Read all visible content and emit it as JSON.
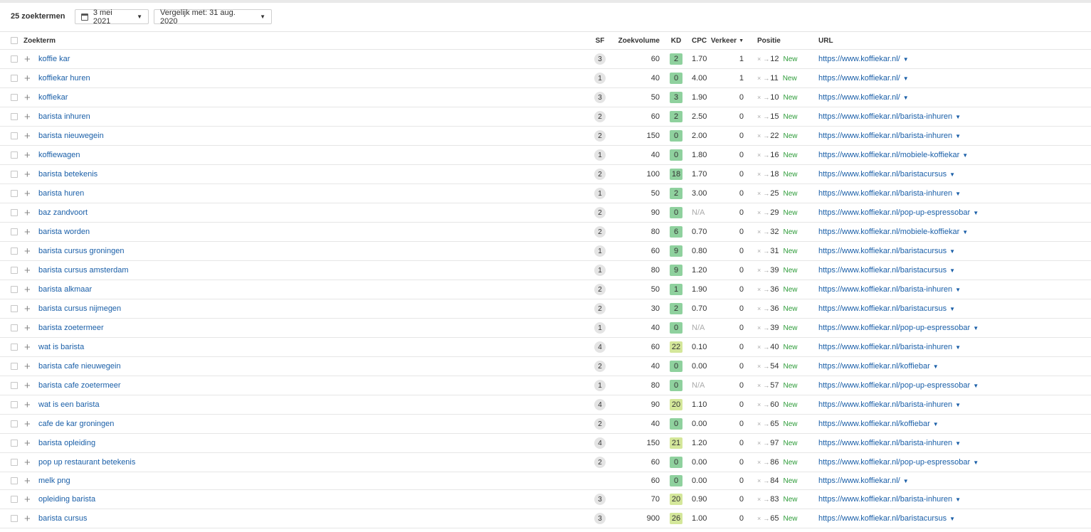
{
  "toolbar": {
    "count_label": "25 zoektermen",
    "date_label": "3 mei 2021",
    "compare_label": "Vergelijk met: 31 aug. 2020"
  },
  "columns": {
    "keyword": "Zoekterm",
    "sf": "SF",
    "volume": "Zoekvolume",
    "kd": "KD",
    "cpc": "CPC",
    "traffic": "Verkeer",
    "position": "Positie",
    "url": "URL"
  },
  "colors": {
    "kd_green": "#8fd19e",
    "kd_yellow_green": "#d4e79a",
    "link": "#1a5fa8",
    "new": "#2e9c3a"
  },
  "rows": [
    {
      "keyword": "koffie kar",
      "sf": "3",
      "volume": "60",
      "kd": "2",
      "kd_color": "#8fd19e",
      "cpc": "1.70",
      "cpc_na": false,
      "traffic": "1",
      "position": "12",
      "status": "New",
      "url": "https://www.koffiekar.nl/"
    },
    {
      "keyword": "koffiekar huren",
      "sf": "1",
      "volume": "40",
      "kd": "0",
      "kd_color": "#8fd19e",
      "cpc": "4.00",
      "cpc_na": false,
      "traffic": "1",
      "position": "11",
      "status": "New",
      "url": "https://www.koffiekar.nl/"
    },
    {
      "keyword": "koffiekar",
      "sf": "3",
      "volume": "50",
      "kd": "3",
      "kd_color": "#8fd19e",
      "cpc": "1.90",
      "cpc_na": false,
      "traffic": "0",
      "position": "10",
      "status": "New",
      "url": "https://www.koffiekar.nl/"
    },
    {
      "keyword": "barista inhuren",
      "sf": "2",
      "volume": "60",
      "kd": "2",
      "kd_color": "#8fd19e",
      "cpc": "2.50",
      "cpc_na": false,
      "traffic": "0",
      "position": "15",
      "status": "New",
      "url": "https://www.koffiekar.nl/barista-inhuren"
    },
    {
      "keyword": "barista nieuwegein",
      "sf": "2",
      "volume": "150",
      "kd": "0",
      "kd_color": "#8fd19e",
      "cpc": "2.00",
      "cpc_na": false,
      "traffic": "0",
      "position": "22",
      "status": "New",
      "url": "https://www.koffiekar.nl/barista-inhuren"
    },
    {
      "keyword": "koffiewagen",
      "sf": "1",
      "volume": "40",
      "kd": "0",
      "kd_color": "#8fd19e",
      "cpc": "1.80",
      "cpc_na": false,
      "traffic": "0",
      "position": "16",
      "status": "New",
      "url": "https://www.koffiekar.nl/mobiele-koffiekar"
    },
    {
      "keyword": "barista betekenis",
      "sf": "2",
      "volume": "100",
      "kd": "18",
      "kd_color": "#8fd19e",
      "cpc": "1.70",
      "cpc_na": false,
      "traffic": "0",
      "position": "18",
      "status": "New",
      "url": "https://www.koffiekar.nl/baristacursus"
    },
    {
      "keyword": "barista huren",
      "sf": "1",
      "volume": "50",
      "kd": "2",
      "kd_color": "#8fd19e",
      "cpc": "3.00",
      "cpc_na": false,
      "traffic": "0",
      "position": "25",
      "status": "New",
      "url": "https://www.koffiekar.nl/barista-inhuren"
    },
    {
      "keyword": "baz zandvoort",
      "sf": "2",
      "volume": "90",
      "kd": "0",
      "kd_color": "#8fd19e",
      "cpc": "N/A",
      "cpc_na": true,
      "traffic": "0",
      "position": "29",
      "status": "New",
      "url": "https://www.koffiekar.nl/pop-up-espressobar"
    },
    {
      "keyword": "barista worden",
      "sf": "2",
      "volume": "80",
      "kd": "6",
      "kd_color": "#8fd19e",
      "cpc": "0.70",
      "cpc_na": false,
      "traffic": "0",
      "position": "32",
      "status": "New",
      "url": "https://www.koffiekar.nl/mobiele-koffiekar"
    },
    {
      "keyword": "barista cursus groningen",
      "sf": "1",
      "volume": "60",
      "kd": "9",
      "kd_color": "#8fd19e",
      "cpc": "0.80",
      "cpc_na": false,
      "traffic": "0",
      "position": "31",
      "status": "New",
      "url": "https://www.koffiekar.nl/baristacursus"
    },
    {
      "keyword": "barista cursus amsterdam",
      "sf": "1",
      "volume": "80",
      "kd": "9",
      "kd_color": "#8fd19e",
      "cpc": "1.20",
      "cpc_na": false,
      "traffic": "0",
      "position": "39",
      "status": "New",
      "url": "https://www.koffiekar.nl/baristacursus"
    },
    {
      "keyword": "barista alkmaar",
      "sf": "2",
      "volume": "50",
      "kd": "1",
      "kd_color": "#8fd19e",
      "cpc": "1.90",
      "cpc_na": false,
      "traffic": "0",
      "position": "36",
      "status": "New",
      "url": "https://www.koffiekar.nl/barista-inhuren"
    },
    {
      "keyword": "barista cursus nijmegen",
      "sf": "2",
      "volume": "30",
      "kd": "2",
      "kd_color": "#8fd19e",
      "cpc": "0.70",
      "cpc_na": false,
      "traffic": "0",
      "position": "36",
      "status": "New",
      "url": "https://www.koffiekar.nl/baristacursus"
    },
    {
      "keyword": "barista zoetermeer",
      "sf": "1",
      "volume": "40",
      "kd": "0",
      "kd_color": "#8fd19e",
      "cpc": "N/A",
      "cpc_na": true,
      "traffic": "0",
      "position": "39",
      "status": "New",
      "url": "https://www.koffiekar.nl/pop-up-espressobar"
    },
    {
      "keyword": "wat is barista",
      "sf": "4",
      "volume": "60",
      "kd": "22",
      "kd_color": "#d4e79a",
      "cpc": "0.10",
      "cpc_na": false,
      "traffic": "0",
      "position": "40",
      "status": "New",
      "url": "https://www.koffiekar.nl/barista-inhuren"
    },
    {
      "keyword": "barista cafe nieuwegein",
      "sf": "2",
      "volume": "40",
      "kd": "0",
      "kd_color": "#8fd19e",
      "cpc": "0.00",
      "cpc_na": false,
      "traffic": "0",
      "position": "54",
      "status": "New",
      "url": "https://www.koffiekar.nl/koffiebar"
    },
    {
      "keyword": "barista cafe zoetermeer",
      "sf": "1",
      "volume": "80",
      "kd": "0",
      "kd_color": "#8fd19e",
      "cpc": "N/A",
      "cpc_na": true,
      "traffic": "0",
      "position": "57",
      "status": "New",
      "url": "https://www.koffiekar.nl/pop-up-espressobar"
    },
    {
      "keyword": "wat is een barista",
      "sf": "4",
      "volume": "90",
      "kd": "20",
      "kd_color": "#d4e79a",
      "cpc": "1.10",
      "cpc_na": false,
      "traffic": "0",
      "position": "60",
      "status": "New",
      "url": "https://www.koffiekar.nl/barista-inhuren"
    },
    {
      "keyword": "cafe de kar groningen",
      "sf": "2",
      "volume": "40",
      "kd": "0",
      "kd_color": "#8fd19e",
      "cpc": "0.00",
      "cpc_na": false,
      "traffic": "0",
      "position": "65",
      "status": "New",
      "url": "https://www.koffiekar.nl/koffiebar"
    },
    {
      "keyword": "barista opleiding",
      "sf": "4",
      "volume": "150",
      "kd": "21",
      "kd_color": "#d4e79a",
      "cpc": "1.20",
      "cpc_na": false,
      "traffic": "0",
      "position": "97",
      "status": "New",
      "url": "https://www.koffiekar.nl/barista-inhuren"
    },
    {
      "keyword": "pop up restaurant betekenis",
      "sf": "2",
      "volume": "60",
      "kd": "0",
      "kd_color": "#8fd19e",
      "cpc": "0.00",
      "cpc_na": false,
      "traffic": "0",
      "position": "86",
      "status": "New",
      "url": "https://www.koffiekar.nl/pop-up-espressobar"
    },
    {
      "keyword": "melk png",
      "sf": "",
      "volume": "60",
      "kd": "0",
      "kd_color": "#8fd19e",
      "cpc": "0.00",
      "cpc_na": false,
      "traffic": "0",
      "position": "84",
      "status": "New",
      "url": "https://www.koffiekar.nl/"
    },
    {
      "keyword": "opleiding barista",
      "sf": "3",
      "volume": "70",
      "kd": "20",
      "kd_color": "#d4e79a",
      "cpc": "0.90",
      "cpc_na": false,
      "traffic": "0",
      "position": "83",
      "status": "New",
      "url": "https://www.koffiekar.nl/barista-inhuren"
    },
    {
      "keyword": "barista cursus",
      "sf": "3",
      "volume": "900",
      "kd": "26",
      "kd_color": "#d4e79a",
      "cpc": "1.00",
      "cpc_na": false,
      "traffic": "0",
      "position": "65",
      "status": "New",
      "url": "https://www.koffiekar.nl/baristacursus"
    }
  ]
}
